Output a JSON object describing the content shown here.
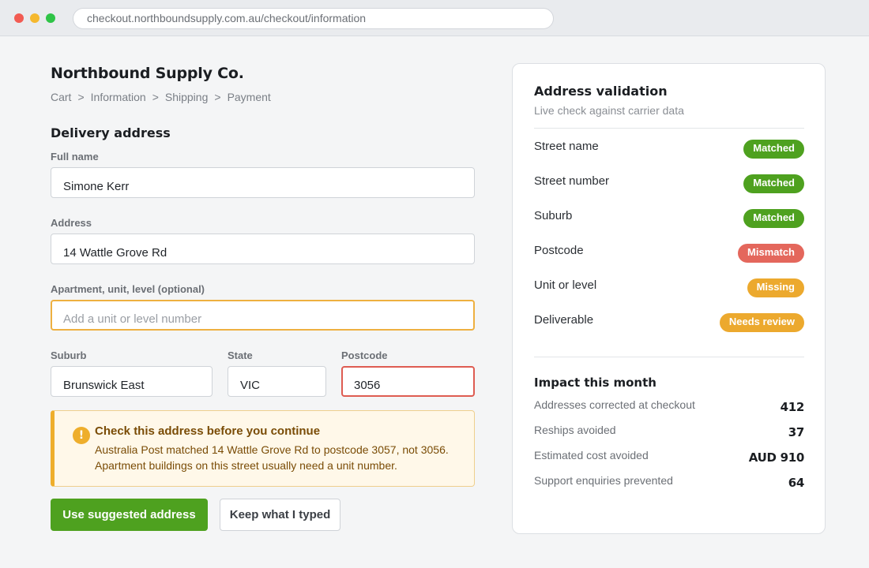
{
  "browser": {
    "url": "checkout.northboundsupply.com.au/checkout/information"
  },
  "store": {
    "name": "Northbound Supply Co."
  },
  "breadcrumb": [
    "Cart",
    "Information",
    "Shipping",
    "Payment"
  ],
  "breadcrumb_separator": ">",
  "form": {
    "title": "Delivery address",
    "full_name": {
      "label": "Full name",
      "value": "Simone Kerr"
    },
    "address": {
      "label": "Address",
      "value": "14 Wattle Grove Rd"
    },
    "apartment": {
      "label": "Apartment, unit, level (optional)",
      "value": "",
      "placeholder": "Add a unit or level number"
    },
    "suburb": {
      "label": "Suburb",
      "value": "Brunswick East"
    },
    "state": {
      "label": "State",
      "value": "VIC"
    },
    "postcode": {
      "label": "Postcode",
      "value": "3056"
    }
  },
  "alert": {
    "icon": "warning-icon",
    "title": "Check this address before you continue",
    "line1": "Australia Post matched 14 Wattle Grove Rd to postcode 3057, not 3056.",
    "line2": "Apartment buildings on this street usually need a unit number."
  },
  "actions": {
    "primary": "Use suggested address",
    "secondary": "Keep what I typed"
  },
  "validation": {
    "title": "Address validation",
    "subtitle": "Live check against carrier data",
    "rows": [
      {
        "label": "Street name",
        "status": "Matched",
        "kind": "matched"
      },
      {
        "label": "Street number",
        "status": "Matched",
        "kind": "matched"
      },
      {
        "label": "Suburb",
        "status": "Matched",
        "kind": "matched"
      },
      {
        "label": "Postcode",
        "status": "Mismatch",
        "kind": "mismatch"
      },
      {
        "label": "Unit or level",
        "status": "Missing",
        "kind": "missing"
      },
      {
        "label": "Deliverable",
        "status": "Needs review",
        "kind": "review"
      }
    ]
  },
  "impact": {
    "title": "Impact this month",
    "rows": [
      {
        "label": "Addresses corrected at checkout",
        "value": "412"
      },
      {
        "label": "Reships avoided",
        "value": "37"
      },
      {
        "label": "Estimated cost avoided",
        "value": "AUD 910"
      },
      {
        "label": "Support enquiries prevented",
        "value": "64"
      }
    ]
  },
  "colors": {
    "primary_green": "#4ea11f",
    "mismatch_red": "#e4675c",
    "warning_amber": "#eca92e"
  }
}
